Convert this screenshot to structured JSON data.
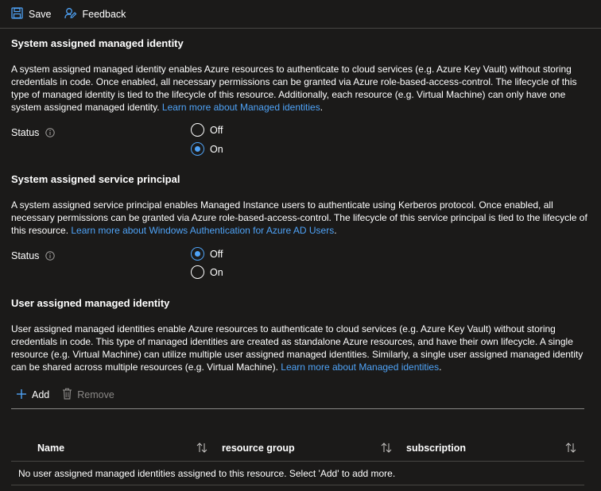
{
  "toolbar": {
    "save_label": "Save",
    "feedback_label": "Feedback"
  },
  "system_identity": {
    "title": "System assigned managed identity",
    "description": "A system assigned managed identity enables Azure resources to authenticate to cloud services (e.g. Azure Key Vault) without storing credentials in code. Once enabled, all necessary permissions can be granted via Azure role-based-access-control. The lifecycle of this type of managed identity is tied to the lifecycle of this resource. Additionally, each resource (e.g. Virtual Machine) can only have one system assigned managed identity. ",
    "link": "Learn more about Managed identities",
    "link_suffix": ".",
    "status_label": "Status",
    "off_label": "Off",
    "on_label": "On",
    "selected": "On"
  },
  "service_principal": {
    "title": "System assigned service principal",
    "description": "A system assigned service principal enables Managed Instance users to authenticate using Kerberos protocol. Once enabled, all necessary permissions can be granted via Azure role-based-access-control. The lifecycle of this service principal is tied to the lifecycle of this resource. ",
    "link": "Learn more about Windows Authentication for Azure AD Users",
    "link_suffix": ".",
    "status_label": "Status",
    "off_label": "Off",
    "on_label": "On",
    "selected": "Off"
  },
  "user_identity": {
    "title": "User assigned managed identity",
    "description": "User assigned managed identities enable Azure resources to authenticate to cloud services (e.g. Azure Key Vault) without storing credentials in code. This type of managed identities are created as standalone Azure resources, and have their own lifecycle. A single resource (e.g. Virtual Machine) can utilize multiple user assigned managed identities. Similarly, a single user assigned managed identity can be shared across multiple resources (e.g. Virtual Machine). ",
    "link": "Learn more about Managed identities",
    "link_suffix": ".",
    "add_label": "Add",
    "remove_label": "Remove"
  },
  "table": {
    "columns": [
      "Name",
      "resource group",
      "subscription"
    ],
    "empty_message": "No user assigned managed identities assigned to this resource. Select 'Add' to add more."
  },
  "colors": {
    "background": "#1b1a19",
    "accent": "#4fa3f7",
    "text": "#ffffff",
    "disabled": "#8a8886"
  },
  "icons": [
    "save-icon",
    "feedback-icon",
    "info-icon",
    "add-icon",
    "trash-icon",
    "sort-icon"
  ]
}
